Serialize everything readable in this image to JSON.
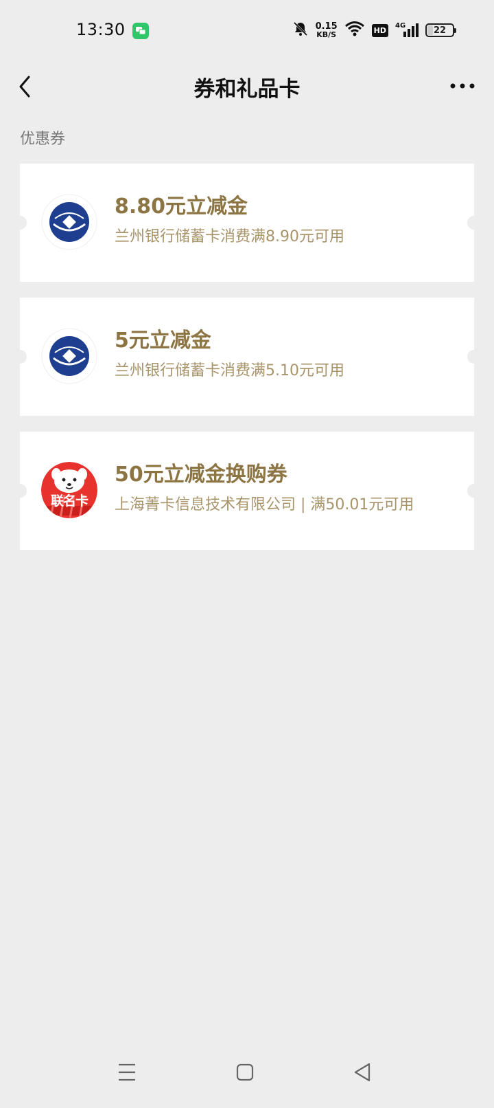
{
  "status_bar": {
    "time": "13:30",
    "net_speed_value": "0.15",
    "net_speed_unit": "KB/S",
    "hd_label": "HD",
    "network_label": "4G",
    "battery_level": "22",
    "battery_fraction": 0.22,
    "icons": [
      "chat-notification-icon",
      "bell-muted-icon",
      "wifi-icon",
      "hd-icon",
      "signal-4g-icon",
      "battery-icon"
    ]
  },
  "header": {
    "title": "券和礼品卡",
    "back_icon": "chevron-left-icon",
    "more_icon": "more-dots-icon"
  },
  "section": {
    "title": "优惠券"
  },
  "coupons": [
    {
      "title": "8.80元立减金",
      "description": "兰州银行储蓄卡消费满8.90元可用",
      "logo": "bank-of-lanzhou-logo"
    },
    {
      "title": "5元立减金",
      "description": "兰州银行储蓄卡消费满5.10元可用",
      "logo": "bank-of-lanzhou-logo"
    },
    {
      "title": "50元立减金换购券",
      "description": "上海菁卡信息技术有限公司 | 满50.01元可用",
      "logo": "joint-card-logo",
      "logo_text": "联名卡"
    }
  ],
  "system_nav": {
    "icons": [
      "menu-icon",
      "home-square-icon",
      "back-triangle-icon"
    ]
  },
  "colors": {
    "background": "#ededed",
    "card": "#ffffff",
    "coupon_title": "#8c7443",
    "coupon_desc": "#a8946a",
    "bank_blue": "#1e3f8f",
    "joint_red": "#e8322e"
  }
}
